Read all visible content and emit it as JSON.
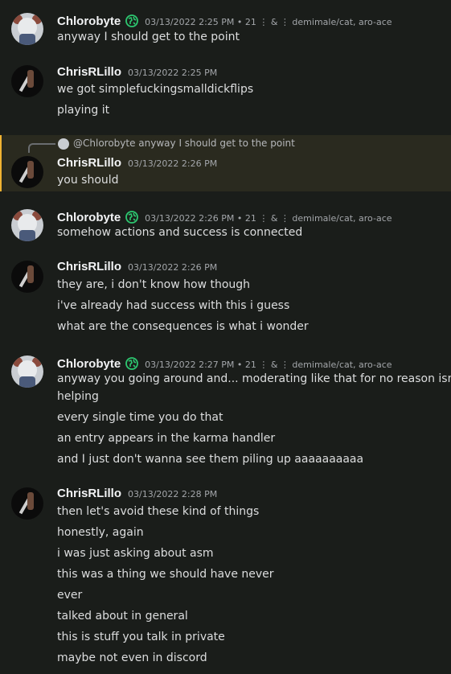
{
  "colors": {
    "background": "#1a1d1a",
    "highlight": "#2a2a1f",
    "accent": "#f0b232",
    "globe": "#2dc770"
  },
  "messages": [
    {
      "author": "Chlorobyte",
      "timestamp": "03/13/2022 2:25 PM • 21 ⋮ & ⋮ demimale/cat, aro-ace",
      "lines": [
        "anyway I should get to the point"
      ]
    },
    {
      "author": "ChrisRLillo",
      "timestamp": "03/13/2022 2:25 PM",
      "lines": [
        "we got simplefuckingsmalldickflips",
        "playing it"
      ]
    },
    {
      "author": "ChrisRLillo",
      "timestamp": "03/13/2022 2:26 PM",
      "reply": "@Chlorobyte anyway I should get to the point",
      "lines": [
        "you should"
      ]
    },
    {
      "author": "Chlorobyte",
      "timestamp": "03/13/2022 2:26 PM • 21 ⋮ & ⋮ demimale/cat, aro-ace",
      "lines": [
        "somehow actions and success is connected"
      ]
    },
    {
      "author": "ChrisRLillo",
      "timestamp": "03/13/2022 2:26 PM",
      "lines": [
        "they are, i don't know how though",
        "i've already had success with this i guess",
        "what are the consequences is what i wonder"
      ]
    },
    {
      "author": "Chlorobyte",
      "timestamp": "03/13/2022 2:27 PM • 21 ⋮ & ⋮ demimale/cat, aro-ace",
      "lines": [
        "anyway you going around and... moderating like that for no reason isn't",
        "helping",
        "every single time you do that",
        "an entry appears in the karma handler",
        "and I just don't wanna see them piling up aaaaaaaaaa"
      ]
    },
    {
      "author": "ChrisRLillo",
      "timestamp": "03/13/2022 2:28 PM",
      "lines": [
        "then let's avoid these kind of things",
        "honestly, again",
        "i was just asking about asm",
        "this was a thing we should have never",
        "ever",
        "talked about in general",
        "this is stuff you talk in private",
        "maybe not even in discord"
      ]
    }
  ]
}
